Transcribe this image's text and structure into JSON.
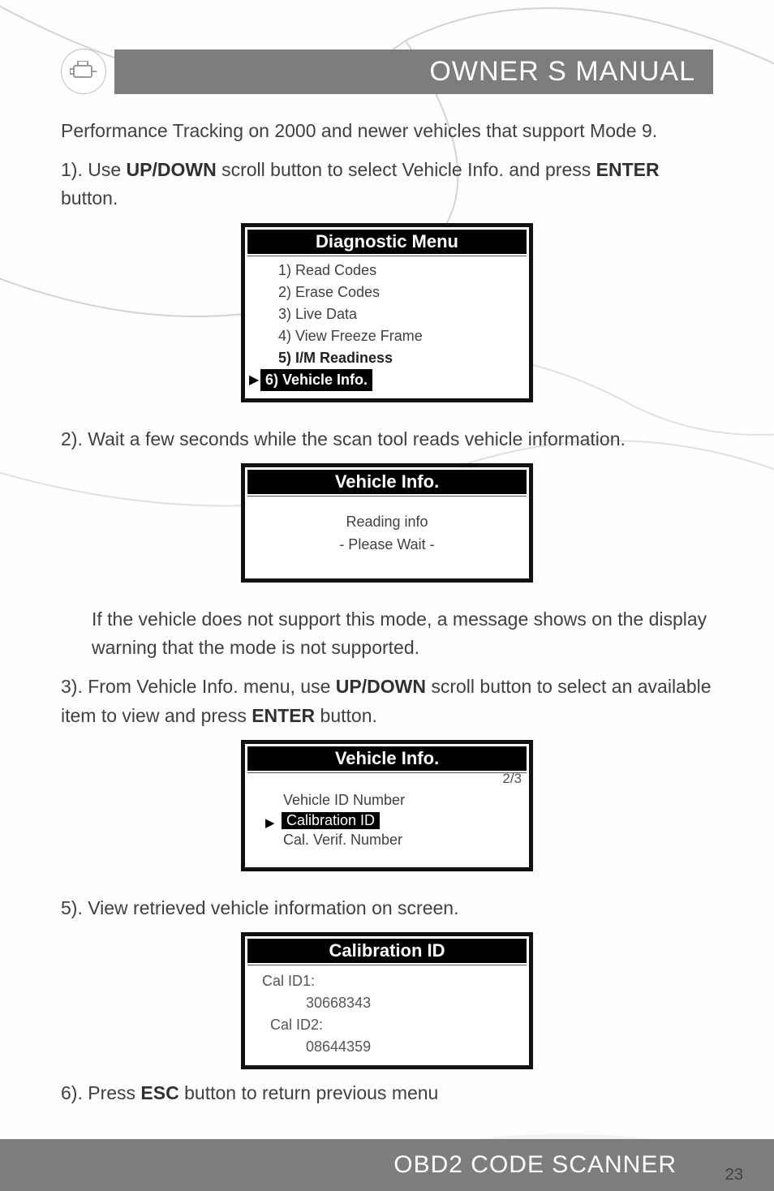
{
  "header": {
    "title": "OWNER S MANUAL",
    "icon": "engine-icon"
  },
  "paragraphs": {
    "intro": "Performance Tracking on 2000 and newer vehicles that support Mode 9.",
    "step1_a": "1). Use ",
    "step1_updown": "UP/DOWN",
    "step1_b": " scroll button to select Vehicle Info. and press ",
    "step1_enter": "ENTER",
    "step1_c": " button.",
    "step2": "2). Wait a few seconds while the scan tool reads vehicle information.",
    "note_a": "If the vehicle does not support this mode, a message shows on the display warning that the mode is not supported.",
    "step3_a": "3). From Vehicle Info. menu, use ",
    "step3_updown": "UP/DOWN",
    "step3_b": " scroll button to select an available item to view and press ",
    "step3_enter": "ENTER",
    "step3_c": " button.",
    "step5": "5). View retrieved vehicle information on screen.",
    "step6_a": "6). Press ",
    "step6_esc": "ESC",
    "step6_b": " button to return previous menu"
  },
  "screen1": {
    "title": "Diagnostic Menu",
    "items": [
      "1) Read Codes",
      "2) Erase Codes",
      "3) Live Data",
      "4) View Freeze Frame",
      "5) I/M Readiness"
    ],
    "selected": "6) Vehicle Info."
  },
  "screen2": {
    "title": "Vehicle Info.",
    "line1": "Reading info",
    "line2": "- Please Wait -"
  },
  "screen3": {
    "title": "Vehicle Info.",
    "page": "2/3",
    "item1": "Vehicle ID Number",
    "selected": "Calibration ID",
    "item3": "Cal. Verif. Number"
  },
  "screen4": {
    "title": "Calibration ID",
    "label1": "Cal ID1:",
    "value1": "30668343",
    "label2": "Cal ID2:",
    "value2": "08644359"
  },
  "footer": {
    "text": "OBD2 CODE SCANNER",
    "page": "23"
  }
}
